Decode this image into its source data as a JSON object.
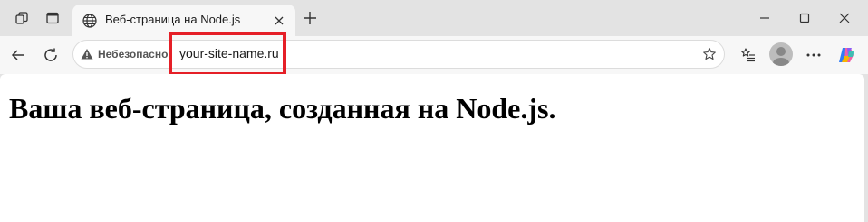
{
  "tab": {
    "title": "Веб-страница на Node.js",
    "icon": "globe-icon"
  },
  "address_bar": {
    "security_label": "Небезопасно",
    "url": "your-site-name.ru"
  },
  "page": {
    "heading": "Ваша веб-страница, созданная на Node.js."
  },
  "colors": {
    "highlight": "#e51f27",
    "chrome_bg": "#e3e3e3",
    "toolbar_bg": "#f7f7f7"
  }
}
